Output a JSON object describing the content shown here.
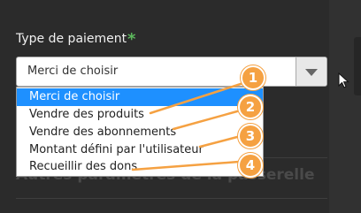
{
  "form": {
    "payment_label": "Type de paiement",
    "required_mark": "*",
    "select_value": "Merci de choisir"
  },
  "dropdown": {
    "options": [
      "Merci de choisir",
      "Vendre des produits",
      "Vendre des abonnements",
      "Montant défini par l'utilisateur",
      "Recueillir des dons"
    ],
    "selected_index": 0
  },
  "section": {
    "title": "Autres paramètres de la passerelle"
  },
  "annotations": {
    "badges": [
      "1",
      "2",
      "3",
      "4"
    ]
  },
  "colors": {
    "background": "#2b2b2b",
    "accent_required": "#5cb85c",
    "selected_option": "#1e90ff",
    "annotation": "#f5a142"
  },
  "icons": {
    "select_toggle": "chevron-down-icon",
    "cursor": "mouse-pointer-icon"
  }
}
